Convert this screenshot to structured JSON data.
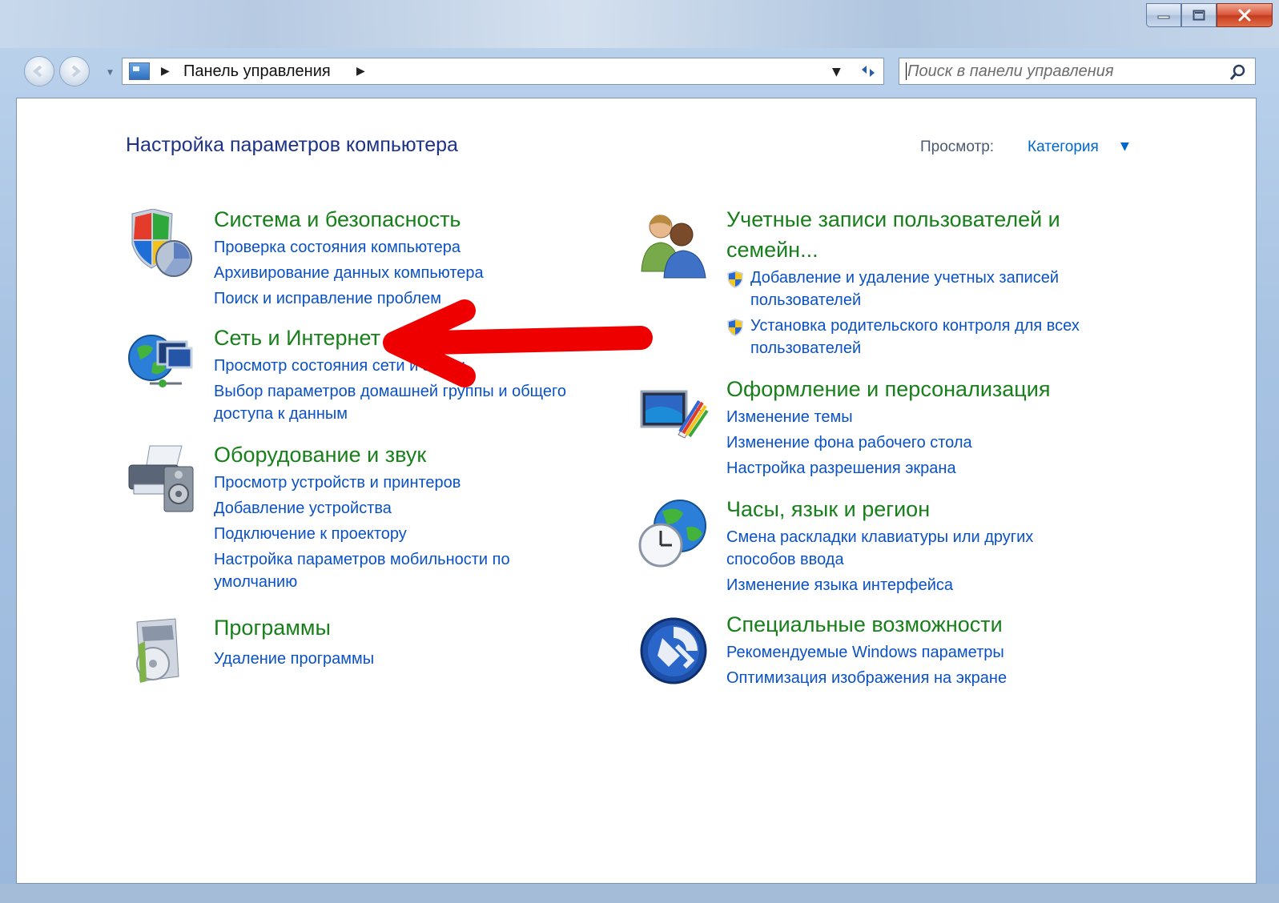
{
  "window": {
    "caption_buttons": [
      "minimize",
      "maximize",
      "close"
    ]
  },
  "navbar": {
    "address_path": "Панель управления",
    "search_placeholder": "Поиск в панели управления"
  },
  "main": {
    "title": "Настройка параметров компьютера",
    "view_label": "Просмотр:",
    "view_value": "Категория"
  },
  "categories_left": [
    {
      "title": "Система и безопасность",
      "icon": "shield-icon",
      "links": [
        "Проверка состояния компьютера",
        "Архивирование данных компьютера",
        "Поиск и исправление проблем"
      ]
    },
    {
      "title": "Сеть и Интернет",
      "icon": "network-globe-icon",
      "links": [
        "Просмотр состояния сети и задач",
        "Выбор параметров домашней группы и общего",
        "доступа к данным"
      ]
    },
    {
      "title": "Оборудование и звук",
      "icon": "printer-icon",
      "links": [
        "Просмотр устройств и принтеров",
        "Добавление устройства",
        "Подключение к проектору",
        "Настройка параметров мобильности по",
        "умолчанию"
      ]
    },
    {
      "title": "Программы",
      "icon": "programs-icon",
      "links": [
        "Удаление программы"
      ]
    }
  ],
  "categories_right": [
    {
      "title_line1": "Учетные записи пользователей и",
      "title_line2": "семейн...",
      "icon": "users-icon",
      "links": [
        "Добавление и удаление учетных записей",
        "пользователей",
        "Установка родительского контроля для всех",
        "пользователей"
      ]
    },
    {
      "title": "Оформление и персонализация",
      "icon": "personalization-icon",
      "links": [
        "Изменение темы",
        "Изменение фона рабочего стола",
        "Настройка разрешения экрана"
      ]
    },
    {
      "title": "Часы, язык и регион",
      "icon": "clock-globe-icon",
      "links": [
        "Смена раскладки клавиатуры или других",
        "способов ввода",
        "Изменение языка интерфейса"
      ]
    },
    {
      "title": "Специальные возможности",
      "icon": "accessibility-icon",
      "links": [
        "Рекомендуемые Windows параметры",
        "Оптимизация изображения на экране"
      ]
    }
  ],
  "colors": {
    "category_title": "#18801a",
    "link": "#0a51c6",
    "annotation_arrow": "#ee0000"
  }
}
